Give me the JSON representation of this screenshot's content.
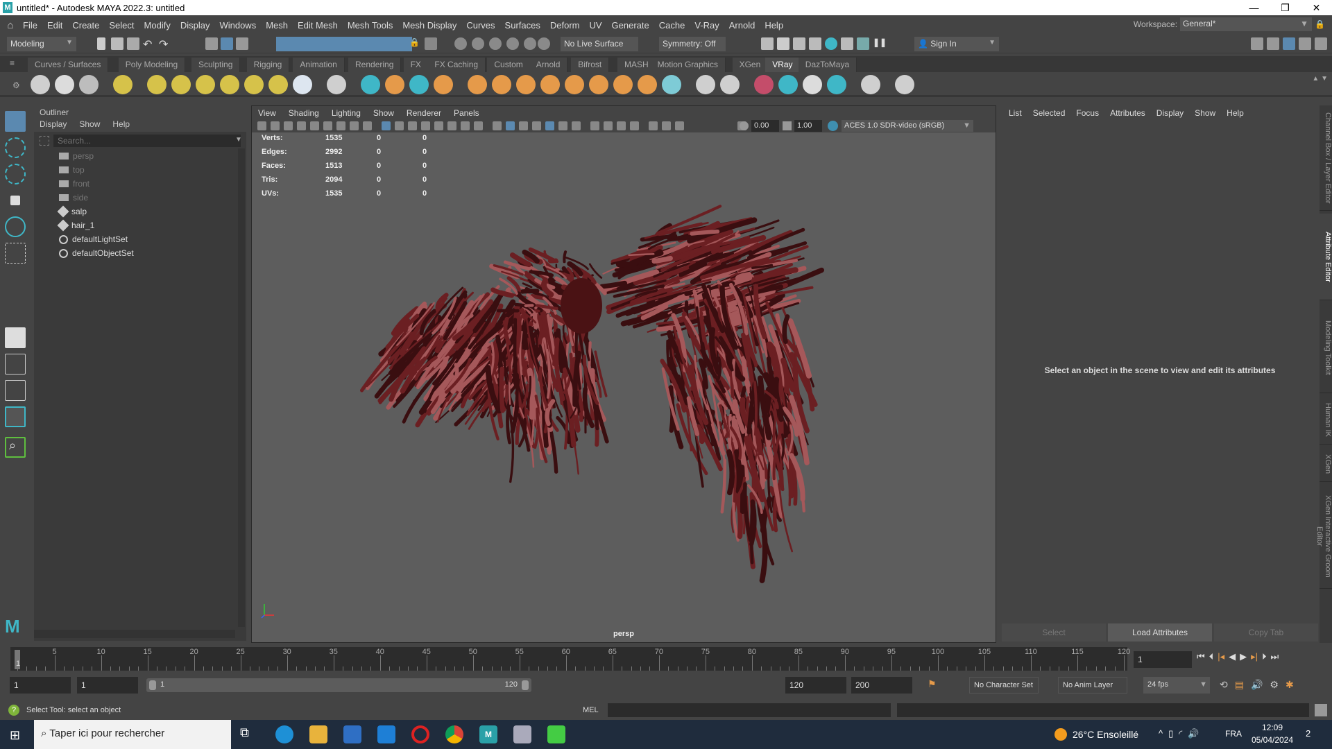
{
  "window": {
    "title": "untitled* - Autodesk MAYA 2022.3: untitled",
    "logo": "M",
    "minimize": "—",
    "maximize": "❐",
    "close": "✕"
  },
  "menubar": {
    "items": [
      "File",
      "Edit",
      "Create",
      "Select",
      "Modify",
      "Display",
      "Windows",
      "Mesh",
      "Edit Mesh",
      "Mesh Tools",
      "Mesh Display",
      "Curves",
      "Surfaces",
      "Deform",
      "UV",
      "Generate",
      "Cache",
      "V-Ray",
      "Arnold",
      "Help"
    ],
    "workspace_label": "Workspace:",
    "workspace_value": "General*"
  },
  "statusline": {
    "menuset": "Modeling",
    "live_surface": "No Live Surface",
    "symmetry": "Symmetry: Off",
    "sign_in": "Sign In"
  },
  "shelf": {
    "tabs": [
      "Curves / Surfaces",
      "Poly Modeling",
      "Sculpting",
      "Rigging",
      "Animation",
      "Rendering",
      "FX",
      "FX Caching",
      "Custom",
      "Arnold",
      "Bifrost",
      "MASH",
      "Motion Graphics",
      "XGen",
      "VRay",
      "DazToMaya"
    ],
    "active_tab": "VRay",
    "icons": [
      {
        "name": "vray-frame-buffer-icon",
        "color": "#cfcfcf"
      },
      {
        "name": "vray-sphere-fade-icon",
        "color": "#dcdcdc"
      },
      {
        "name": "vray-render-icon",
        "color": "#bdbdbd"
      },
      {
        "name": "vray-light-lister-icon",
        "color": "#d6c24a"
      },
      {
        "name": "vray-dome-light-icon",
        "color": "#d6c24a"
      },
      {
        "name": "vray-spot-light-icon",
        "color": "#d6c24a"
      },
      {
        "name": "vray-sphere-light-icon",
        "color": "#d6c24a"
      },
      {
        "name": "vray-mesh-light-icon",
        "color": "#d6c24a"
      },
      {
        "name": "vray-ies-light-icon",
        "color": "#d6c24a"
      },
      {
        "name": "vray-sun-icon",
        "color": "#d6c24a"
      },
      {
        "name": "vray-plane-icon",
        "color": "#dde6f0"
      },
      {
        "name": "vray-proxy-icon",
        "color": "#cfcfcf"
      },
      {
        "name": "vray-proxy-export-icon",
        "color": "#3fb7c7"
      },
      {
        "name": "vray-scene-icon",
        "color": "#e59a4a"
      },
      {
        "name": "vray-volume-icon",
        "color": "#3fb7c7"
      },
      {
        "name": "vray-displacement-icon",
        "color": "#e59a4a"
      },
      {
        "name": "vray-object-props-icon",
        "color": "#e59a4a"
      },
      {
        "name": "vray-fur-icon",
        "color": "#e59a4a"
      },
      {
        "name": "vray-clipper-icon",
        "color": "#e59a4a"
      },
      {
        "name": "vray-grid-icon",
        "color": "#e59a4a"
      },
      {
        "name": "vray-instancer-icon",
        "color": "#e59a4a"
      },
      {
        "name": "vray-material-icon",
        "color": "#e59a4a"
      },
      {
        "name": "vray-channels-icon",
        "color": "#e59a4a"
      },
      {
        "name": "vray-settings-icon",
        "color": "#e59a4a"
      },
      {
        "name": "vray-shader-icon",
        "color": "#7ecbd6"
      },
      {
        "name": "vray-convert-icon",
        "color": "#cfcfcf"
      },
      {
        "name": "vray-import-icon",
        "color": "#cfcfcf"
      },
      {
        "name": "vray-material-ball-icon",
        "color": "#c44d6a"
      },
      {
        "name": "vray-multi-icon",
        "color": "#3fb7c7"
      },
      {
        "name": "vray-palette-icon",
        "color": "#dcdcdc"
      },
      {
        "name": "vray-region-icon",
        "color": "#3fb7c7"
      },
      {
        "name": "vray-plugin-icon",
        "color": "#cfcfcf"
      },
      {
        "name": "vray-logo-icon",
        "color": "#cfcfcf"
      }
    ]
  },
  "outliner": {
    "title": "Outliner",
    "menu": [
      "Display",
      "Show",
      "Help"
    ],
    "search_placeholder": "Search...",
    "items": [
      {
        "label": "persp",
        "type": "camera",
        "dim": true
      },
      {
        "label": "top",
        "type": "camera",
        "dim": true
      },
      {
        "label": "front",
        "type": "camera",
        "dim": true
      },
      {
        "label": "side",
        "type": "camera",
        "dim": true
      },
      {
        "label": "salp",
        "type": "mesh",
        "dim": false
      },
      {
        "label": "hair_1",
        "type": "mesh",
        "dim": false
      },
      {
        "label": "defaultLightSet",
        "type": "set",
        "dim": false
      },
      {
        "label": "defaultObjectSet",
        "type": "set",
        "dim": false
      }
    ]
  },
  "viewport": {
    "menu": [
      "View",
      "Shading",
      "Lighting",
      "Show",
      "Renderer",
      "Panels"
    ],
    "exposure": "0.00",
    "gamma": "1.00",
    "color_space": "ACES 1.0 SDR-video (sRGB)",
    "camera": "persp",
    "hud": [
      {
        "label": "Verts:",
        "v": [
          "1535",
          "0",
          "0"
        ]
      },
      {
        "label": "Edges:",
        "v": [
          "2992",
          "0",
          "0"
        ]
      },
      {
        "label": "Faces:",
        "v": [
          "1513",
          "0",
          "0"
        ]
      },
      {
        "label": "Tris:",
        "v": [
          "2094",
          "0",
          "0"
        ]
      },
      {
        "label": "UVs:",
        "v": [
          "1535",
          "0",
          "0"
        ]
      }
    ],
    "hair_color": "#6b1f22"
  },
  "attribute_editor": {
    "menu": [
      "List",
      "Selected",
      "Focus",
      "Attributes",
      "Display",
      "Show",
      "Help"
    ],
    "message": "Select an object in the scene to view and edit its attributes",
    "buttons": [
      "Select",
      "Load Attributes",
      "Copy Tab"
    ]
  },
  "side_tabs": [
    "Channel Box / Layer Editor",
    "Attribute Editor",
    "Modeling Toolkit",
    "Human IK",
    "XGen",
    "XGen Interactive Groom Editor"
  ],
  "timeline": {
    "ticks": [
      "5",
      "10",
      "15",
      "20",
      "25",
      "30",
      "35",
      "40",
      "45",
      "50",
      "55",
      "60",
      "65",
      "70",
      "75",
      "80",
      "85",
      "90",
      "95",
      "100",
      "105",
      "110",
      "115",
      "120"
    ],
    "current_frame_marker": "1",
    "current_frame": "1",
    "min": 1,
    "max": 120
  },
  "range": {
    "start": "1",
    "anim_start": "1",
    "range_start": "1",
    "range_end": "120",
    "end": "120",
    "anim_end": "200",
    "character_set": "No Character Set",
    "anim_layer": "No Anim Layer",
    "fps": "24 fps"
  },
  "commandline": {
    "help": "Select Tool: select an object",
    "lang": "MEL"
  },
  "taskbar": {
    "search": "Taper ici pour rechercher",
    "weather": "26°C  Ensoleillé",
    "lang": "FRA",
    "time": "12:09",
    "date": "05/04/2024",
    "notifications": "2"
  }
}
